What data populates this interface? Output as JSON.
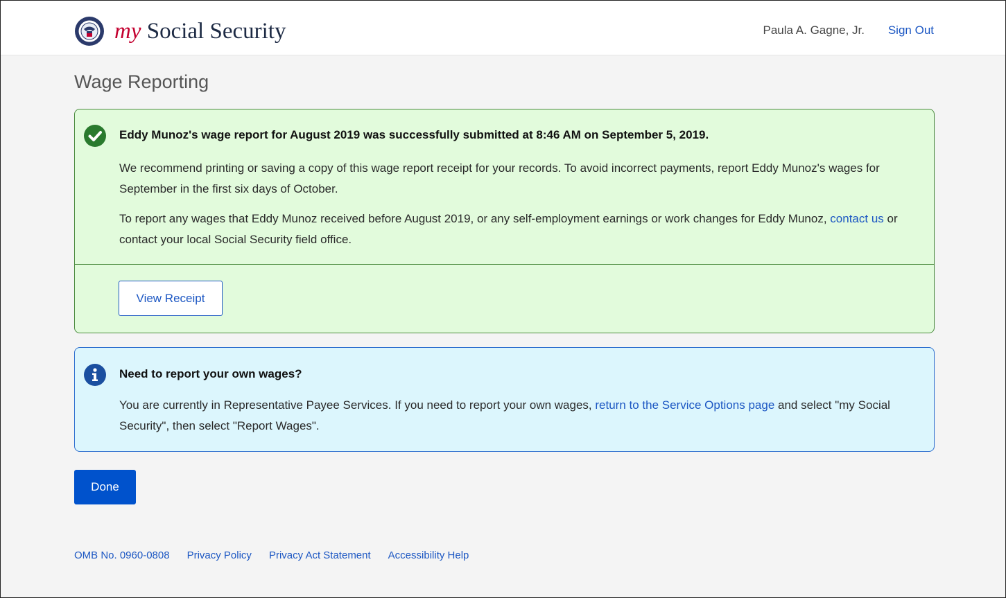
{
  "header": {
    "brand_my": "my",
    "brand_rest": " Social Security",
    "user_name": "Paula A. Gagne, Jr.",
    "sign_out": "Sign Out"
  },
  "page": {
    "title": "Wage Reporting"
  },
  "success_alert": {
    "icon": "check-circle-icon",
    "heading": "Eddy Munoz's wage report for August 2019 was successfully submitted at 8:46 AM on September 5, 2019.",
    "p1": "We recommend printing or saving a copy of this wage report receipt for your records. To avoid incorrect payments, report Eddy Munoz's wages for September in the first six days of October.",
    "p2_before": "To report any wages that Eddy Munoz received before August 2019, or any self-employment earnings or work changes for Eddy Munoz, ",
    "p2_link": "contact us",
    "p2_after": " or contact your local Social Security field office.",
    "view_receipt": "View Receipt"
  },
  "info_alert": {
    "icon": "info-circle-icon",
    "heading": "Need to report your own wages?",
    "p_before": "You are currently in Representative Payee Services. If you need to report your own wages, ",
    "p_link": "return to the Service Options page",
    "p_after": " and select \"my Social Security\", then select \"Report Wages\"."
  },
  "done_button": "Done",
  "footer": {
    "links": [
      "OMB No. 0960-0808",
      "Privacy Policy",
      "Privacy Act Statement",
      "Accessibility Help"
    ]
  },
  "colors": {
    "brand_red": "#c3002f",
    "link_blue": "#1c57c3",
    "success_bg": "#e2fbdc",
    "info_bg": "#dcf6fd",
    "primary_button": "#0052cc"
  }
}
